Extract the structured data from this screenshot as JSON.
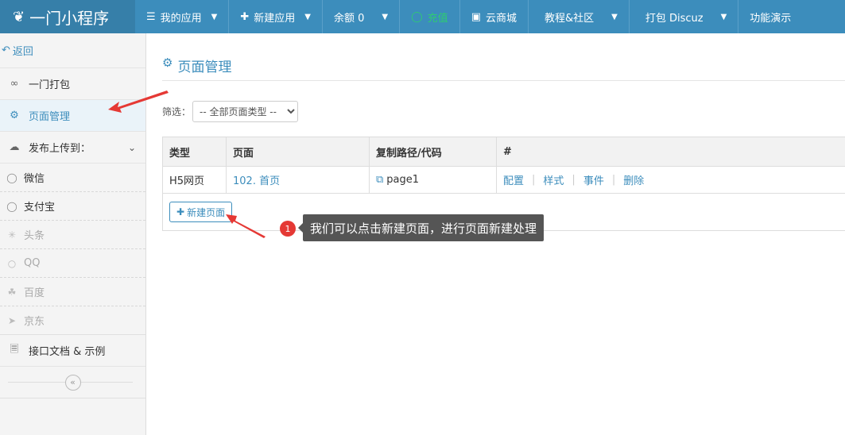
{
  "app": {
    "title": "一门小程序",
    "logo_icon": "leaf-icon"
  },
  "nav": {
    "my_apps": "我的应用",
    "new_app": "新建应用",
    "balance": "余额 0",
    "recharge": "充值",
    "cloud_mall": "云商城",
    "tutorial": "教程&社区",
    "pack_discuz": "打包 Discuz",
    "features": "功能演示"
  },
  "sidebar": {
    "back": "返回",
    "items": [
      {
        "label": "一门打包",
        "icon": "grid-icon"
      },
      {
        "label": "页面管理",
        "icon": "page-gear-icon"
      },
      {
        "label": "发布上传到：",
        "icon": "cloud-upload-icon"
      }
    ],
    "publish_targets": [
      {
        "label": "微信",
        "icon": "wechat-icon",
        "enabled": true
      },
      {
        "label": "支付宝",
        "icon": "alipay-icon",
        "enabled": true
      },
      {
        "label": "头条",
        "icon": "toutiao-icon",
        "enabled": false
      },
      {
        "label": "QQ",
        "icon": "qq-icon",
        "enabled": false
      },
      {
        "label": "百度",
        "icon": "baidu-icon",
        "enabled": false
      },
      {
        "label": "京东",
        "icon": "jd-icon",
        "enabled": false
      }
    ],
    "api_docs": "接口文档 & 示例"
  },
  "main": {
    "title": "页面管理",
    "filter_label": "筛选：",
    "filter_value": "-- 全部页面类型 --",
    "table": {
      "headers": [
        "类型",
        "页面",
        "复制路径/代码",
        "#"
      ],
      "rows": [
        {
          "type": "H5网页",
          "page": "102. 首页",
          "path": "page1",
          "actions": [
            "配置",
            "样式",
            "事件",
            "删除"
          ]
        }
      ]
    },
    "new_page": "新建页面"
  },
  "annotation": {
    "step": "1",
    "text": "我们可以点击新建页面，进行页面新建处理",
    "color": "#e53935"
  },
  "colors": {
    "primary": "#3c8dbc",
    "recharge": "#2ecc71"
  }
}
